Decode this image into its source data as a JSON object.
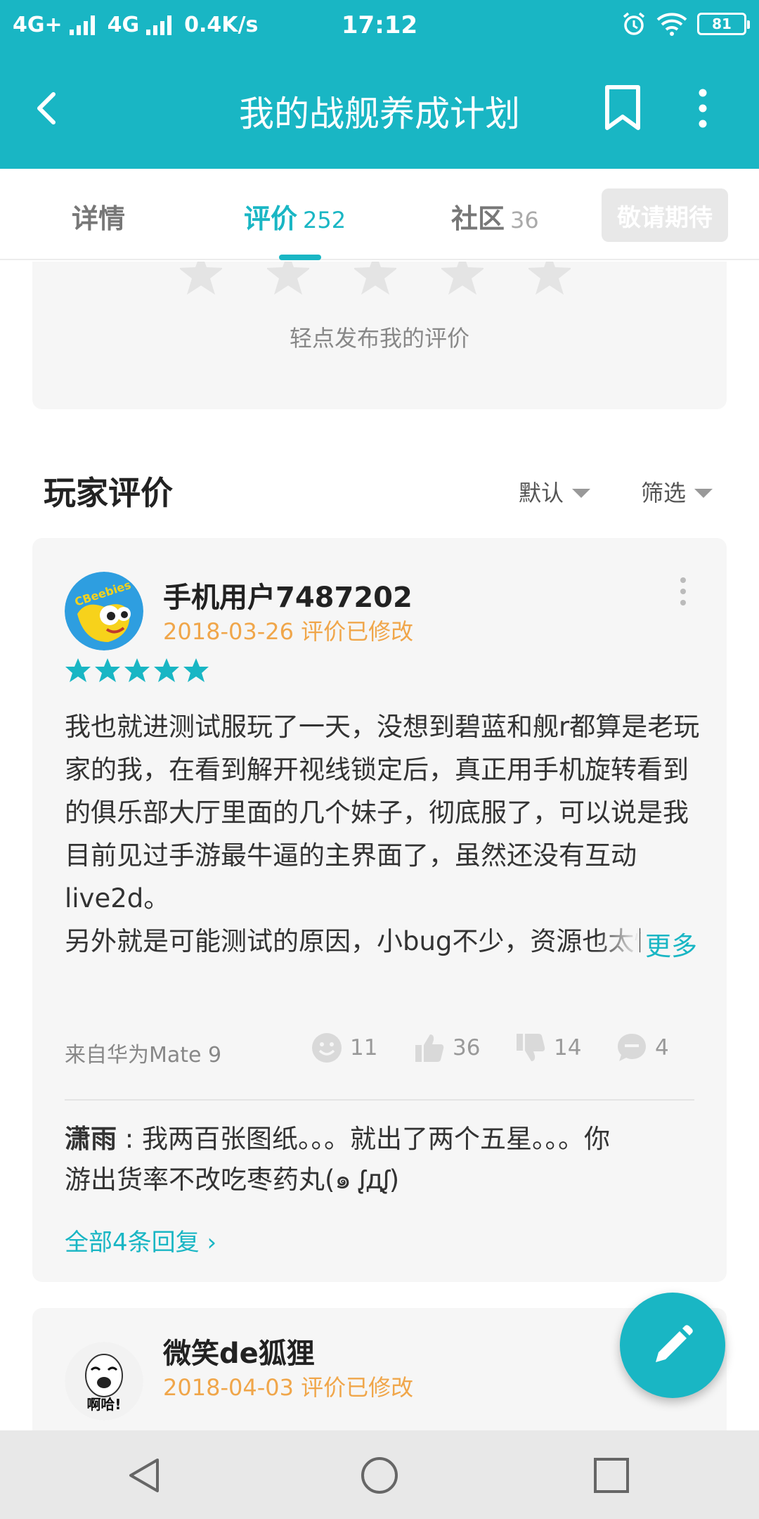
{
  "status_bar": {
    "network_left": "4G+",
    "network_right": "4G",
    "speed": "0.4K/s",
    "time": "17:12",
    "battery": "81"
  },
  "app_bar": {
    "title": "我的战舰养成计划"
  },
  "tabs": [
    {
      "label": "详情",
      "count": ""
    },
    {
      "label": "评价",
      "count": "252"
    },
    {
      "label": "社区",
      "count": "36"
    }
  ],
  "coming_soon": "敬请期待",
  "rating": {
    "hint": "轻点发布我的评价"
  },
  "reviews_section": {
    "title": "玩家评价",
    "sort_label": "默认",
    "filter_label": "筛选"
  },
  "review1": {
    "username": "手机用户7487202",
    "date": "2018-03-26",
    "modified": "评价已修改",
    "stars": 5,
    "text_p1": "我也就进测试服玩了一天，没想到碧蓝和舰r都算是老玩家的我，在看到解开视线锁定后，真正用手机旋转看到的俱乐部大厅里面的几个妹子，彻底服了，可以说是我目前见过手游最牛逼的主界面了，虽然还没有互动live2d。",
    "text_p2": "另外就是可能测试的原因，小bug不少，资源也太慢了，想造什么都没有，舰船图纸和装备图纸",
    "more": "更多",
    "device": "来自华为Mate 9",
    "funny_count": "11",
    "like_count": "36",
    "dislike_count": "14",
    "comment_count": "4",
    "reply_author": "潇雨",
    "reply_text": "我两百张图纸。。。就出了两个五星。。。你游出货率不改吃枣药丸(๑ ᶘдᶘ)",
    "all_replies": "全部4条回复"
  },
  "review2": {
    "username": "微笑de狐狸",
    "date": "2018-04-03",
    "modified": "评价已修改",
    "avatar_caption": "啊哈!"
  },
  "colors": {
    "accent": "#19b6c4",
    "date": "#f0a64a",
    "card_bg": "#f6f6f6"
  }
}
